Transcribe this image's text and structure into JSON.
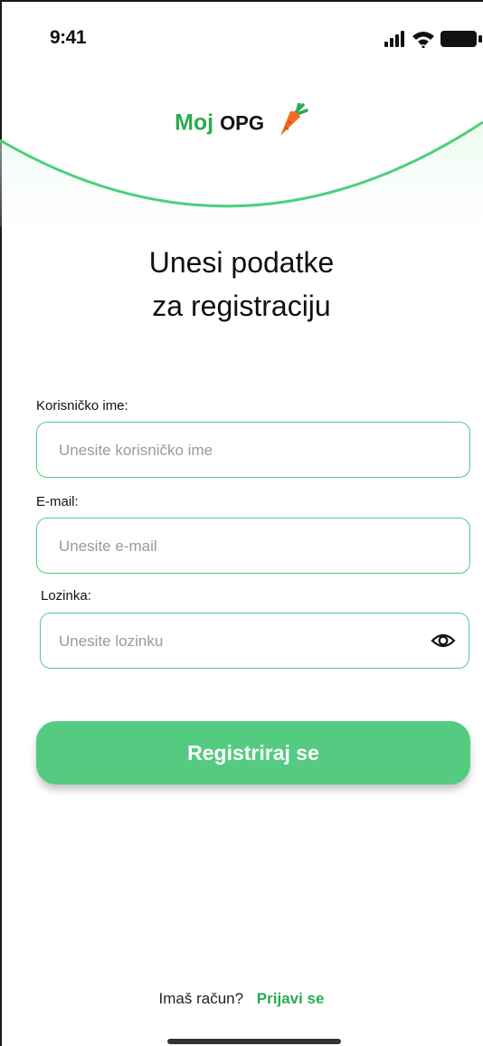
{
  "status_bar": {
    "time": "9:41",
    "icons": [
      "signal-icon",
      "wifi-icon",
      "battery-icon"
    ]
  },
  "brand": {
    "part1": "Moj",
    "part2": "OPG",
    "icon": "carrot-icon",
    "accent_color": "#2bab52",
    "curve_color": "#4cd07d"
  },
  "heading": {
    "line1": "Unesi podatke",
    "line2": "za registraciju"
  },
  "form": {
    "username": {
      "label": "Korisničko ime:",
      "placeholder": "Unesite korisničko ime",
      "value": ""
    },
    "email": {
      "label": "E-mail:",
      "placeholder": "Unesite e-mail",
      "value": ""
    },
    "password": {
      "label": "Lozinka:",
      "placeholder": "Unesite lozinku",
      "value": "",
      "toggle_icon": "eye-icon"
    }
  },
  "register_button": {
    "label": "Registriraj se",
    "color": "#55cb82"
  },
  "footer": {
    "question": "Imaš račun?",
    "link": "Prijavi se"
  }
}
